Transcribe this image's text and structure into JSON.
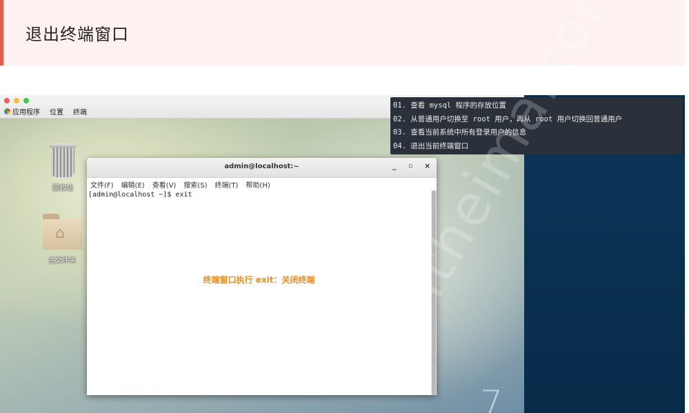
{
  "slide": {
    "title": "退出终端窗口",
    "accent_color": "#e35a4e"
  },
  "desktop": {
    "menubar": {
      "apps": "应用程序",
      "places": "位置",
      "terminal": "终端"
    },
    "icons": {
      "trash_label": "回收站",
      "home_label": "主文件夹"
    }
  },
  "terminal": {
    "title": "admin@localhost:~",
    "controls": {
      "minimize": "_",
      "maximize": "▫",
      "close": "×"
    },
    "menu": [
      "文件(F)",
      "编辑(E)",
      "查看(V)",
      "搜索(S)",
      "终端(T)",
      "帮助(H)"
    ],
    "prompt_line": "[admin@localhost ~]$ exit",
    "annotation": "终端窗口执行 exit：关闭终端",
    "annotation_color": "#f08a1c"
  },
  "steps": [
    "01. 查看 mysql 程序的存放位置",
    "02. 从普通用户切换至 root 用户，再从 root 用户切换回普通用户",
    "03. 查看当前系统中所有登录用户的信息",
    "04. 退出当前终端窗口"
  ],
  "watermark": "itheima.com",
  "wallpaper_mark": "7"
}
